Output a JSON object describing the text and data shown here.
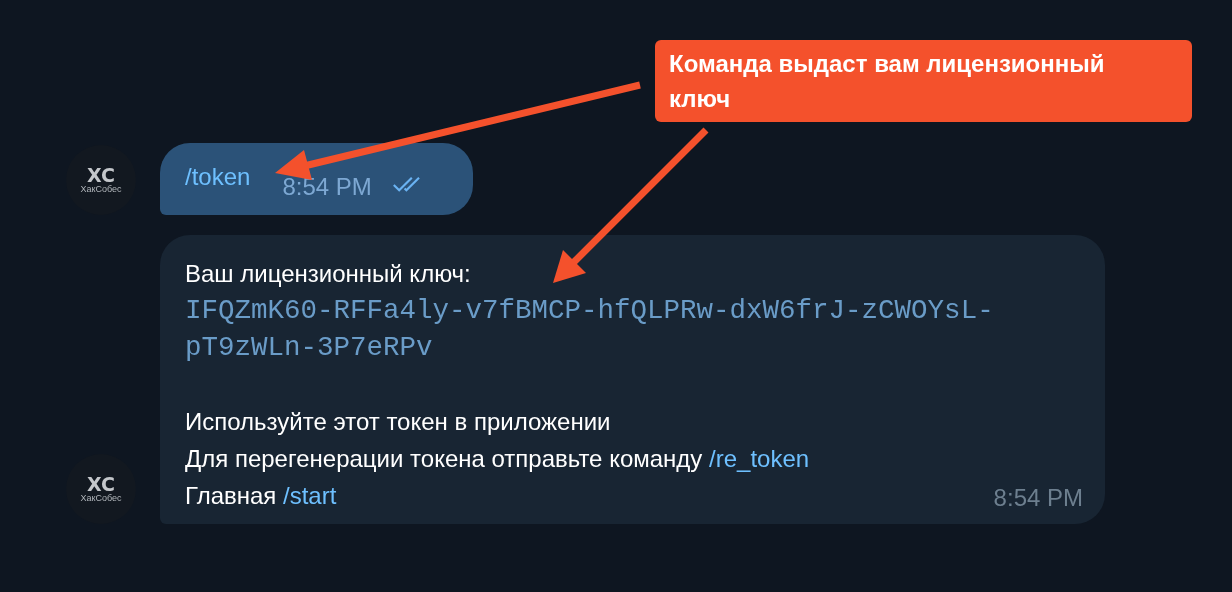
{
  "callout": {
    "text": "Команда выдаст вам лицензионный ключ"
  },
  "messages": [
    {
      "kind": "outgoing",
      "avatar": {
        "initials": "XC",
        "caption": "ХакСобес"
      },
      "command": "/token",
      "time": "8:54 PM",
      "read": true
    },
    {
      "kind": "incoming",
      "avatar": {
        "initials": "XC",
        "caption": "ХакСобес"
      },
      "paragraphs": [
        [
          {
            "kind": "text",
            "text": "Ваш лицензионный ключ:"
          },
          {
            "kind": "code",
            "text": "IFQZmK60-RFFa4ly-v7fBMCP-hfQLPRw-dxW6frJ-zCWOYsL-pT9zWLn-3P7eRPv"
          }
        ],
        [
          {
            "kind": "text",
            "text": "Используйте этот токен в приложении"
          },
          {
            "kind": "text",
            "text": "Для перегенерации токена отправьте команду ",
            "link": "/re_token"
          },
          {
            "kind": "text",
            "text": "Главная ",
            "link": "/start"
          }
        ]
      ],
      "time": "8:54 PM"
    }
  ]
}
